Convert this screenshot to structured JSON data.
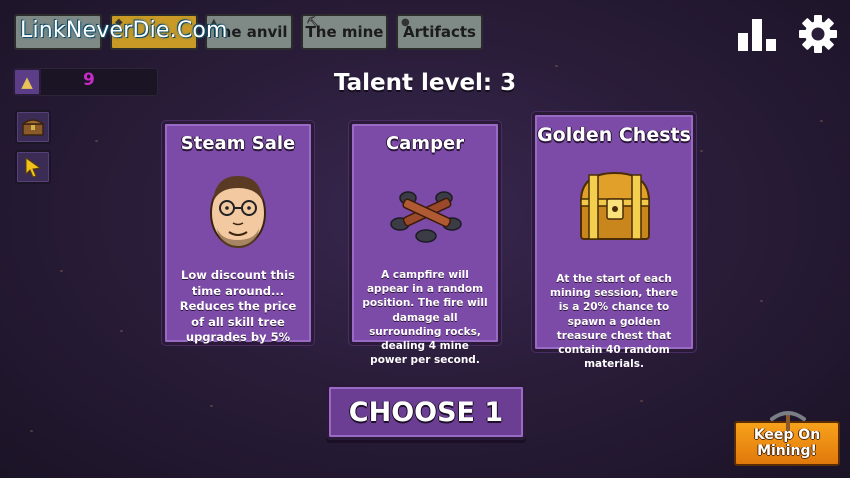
{
  "watermark": "LinkNeverDie.Com",
  "tabs": [
    {
      "label": ""
    },
    {
      "label": ""
    },
    {
      "label": "The anvil"
    },
    {
      "label": "The mine"
    },
    {
      "label": "Artifacts"
    }
  ],
  "resource": {
    "value": "9",
    "icon": "triangle-gem-icon"
  },
  "side_buttons": [
    {
      "icon": "treasure-chest-icon"
    },
    {
      "icon": "cursor-arrow-icon"
    }
  ],
  "talent_title": "Talent level: 3",
  "cards": [
    {
      "title": "Steam Sale",
      "description": "Low discount this time around... Reduces the price of all skill tree upgrades by 5%",
      "art": "bearded-man-portrait"
    },
    {
      "title": "Camper",
      "description": "A campfire will appear in a random position. The fire will damage all surrounding rocks, dealing 4 mine power per second.",
      "art": "campfire-logs"
    },
    {
      "title": "Golden Chests",
      "description": "At the start of each mining session, there is a 20% chance to spawn a golden treasure chest that contain 40 random materials.",
      "art": "golden-chest"
    }
  ],
  "choose_label": "CHOOSE 1",
  "keep_mining_label": "Keep On Mining!",
  "colors": {
    "card": "#7c4aa7",
    "resource_value": "#c42bc7",
    "keep_button": "#f09416",
    "active_tab": "#c99a25"
  }
}
